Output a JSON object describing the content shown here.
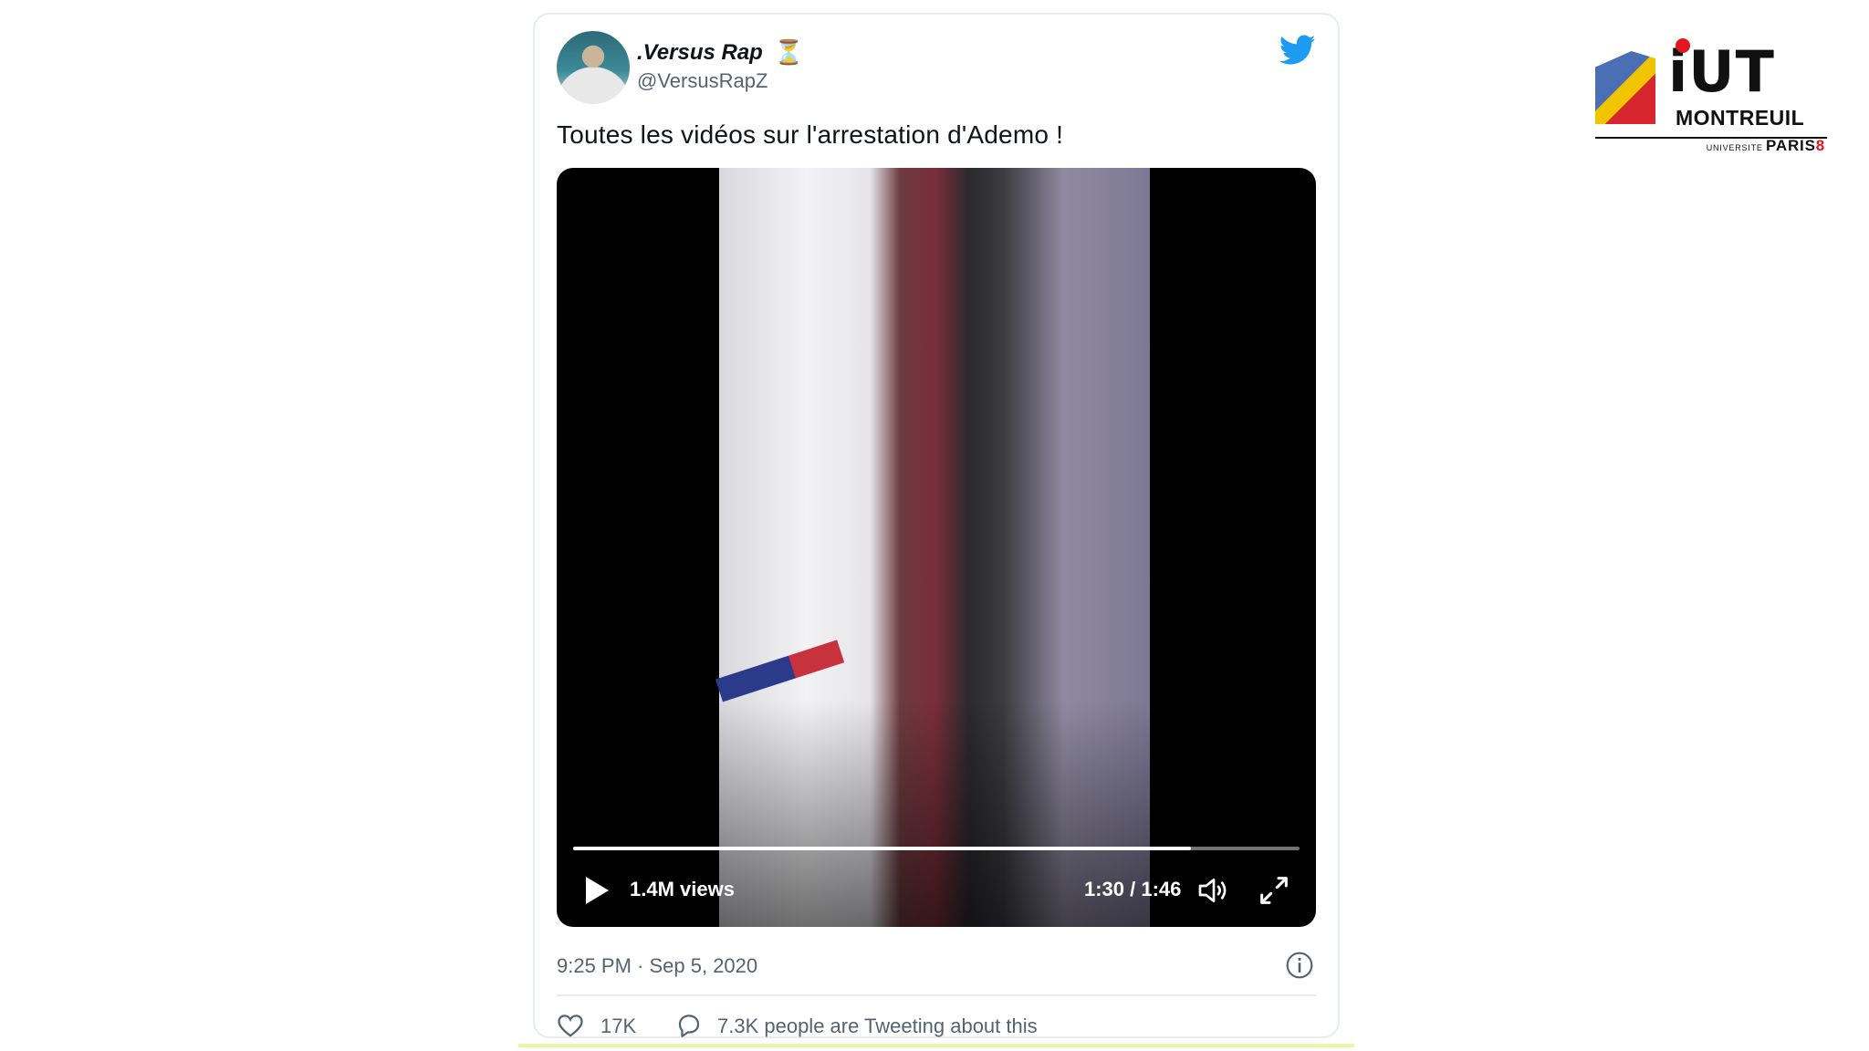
{
  "tweet": {
    "display_name": ".Versus Rap",
    "name_badge": "⏳",
    "handle": "@VersusRapZ",
    "text": "Toutes les vidéos sur l'arrestation d'Ademo !",
    "video": {
      "views": "1.4M views",
      "time": "1:30 / 1:46",
      "progress": 0.85
    },
    "timestamp": "9:25 PM · Sep 5, 2020",
    "like_count": "17K",
    "tweeting_text": "7.3K people are Tweeting about this"
  },
  "logo": {
    "mark": "iUT",
    "city": "MONTREUIL",
    "university_prefix": "UNIVERSITE",
    "university_name": "PARIS",
    "university_number": "8"
  },
  "colors": {
    "twitter_blue": "#1d9bf0",
    "muted_text": "#536471",
    "logo_red": "#e3161f"
  },
  "icons": [
    "twitter-bird-icon",
    "play-icon",
    "volume-icon",
    "fullscreen-icon",
    "info-icon",
    "heart-icon",
    "reply-bubble-icon"
  ]
}
